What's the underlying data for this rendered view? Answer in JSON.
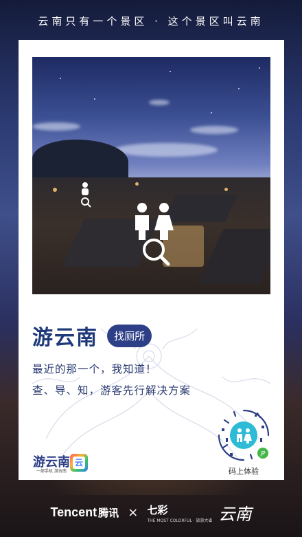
{
  "header": {
    "text": "云南只有一个景区 · 这个景区叫云南"
  },
  "card": {
    "title": "游云南",
    "tag": "找厕所",
    "line1": "最近的那一个，我知道！",
    "line2": "查、导、知，游客先行解决方案"
  },
  "qr": {
    "label": "码上体验"
  },
  "logos": {
    "youyunnan_text": "游云南",
    "youyunnan_sub": "一部手机 游云南",
    "app_icon_glyph": "云"
  },
  "footer": {
    "tencent_en": "Tencent",
    "tencent_cn": "腾讯",
    "times": "×",
    "partner_main": "七彩",
    "partner_sub": "THE MOST COLORFUL · 旅游大省",
    "partner_big": "云南"
  },
  "colors": {
    "accent": "#2d3f86",
    "text": "#2a3a72",
    "card": "#ffffff"
  }
}
